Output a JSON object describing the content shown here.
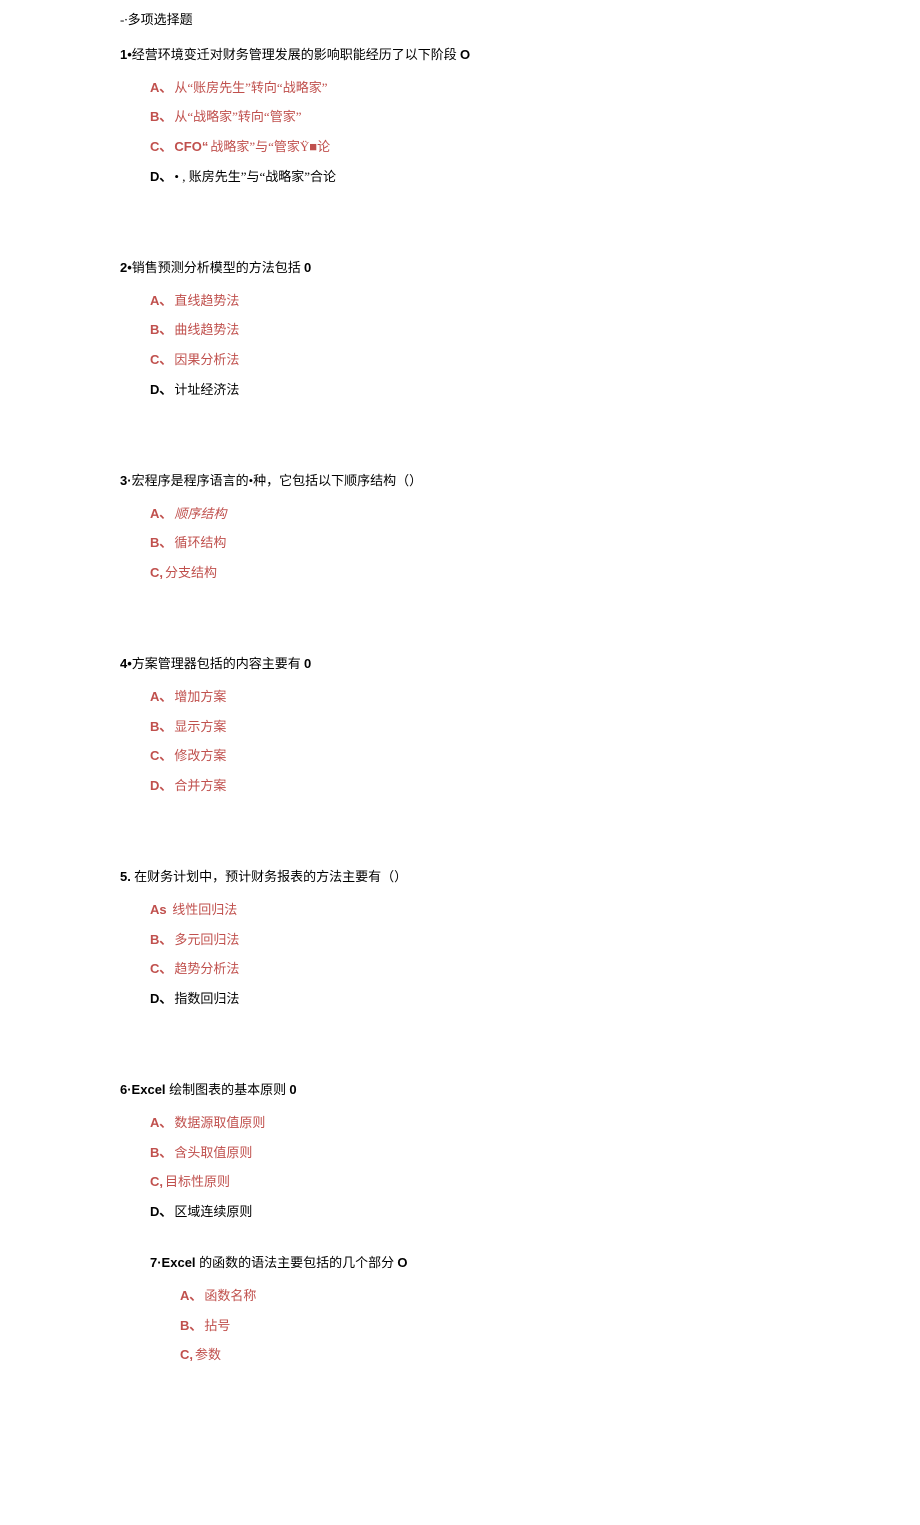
{
  "heading": "-∙多项选择题",
  "q1": {
    "stem_pre": "1•",
    "stem_txt": "经营环境变迁对财务管理发展的影响职能经历了以下阶段 ",
    "stem_suf": "O",
    "a_l": "A、",
    "a_t": "从“账房先生”转向“战略家”",
    "b_l": "B、",
    "b_t": "从“战略家”转向“管家”",
    "c_l": "C、",
    "c_rt": "CFO“",
    "c_t": "战略家”与“管家Ÿ■论",
    "d_l": "D、",
    "d_t": "• , 账房先生”与“战略家”合论"
  },
  "q2": {
    "stem_pre": "2•",
    "stem_txt": "销售预测分析模型的方法包括 ",
    "stem_suf": "0",
    "a_l": "A、",
    "a_t": "直线趋势法",
    "b_l": "B、",
    "b_t": "曲线趋势法",
    "c_l": "C、",
    "c_t": "因果分析法",
    "d_l": "D、",
    "d_t": "计址经济法"
  },
  "q3": {
    "stem_pre": "3·",
    "stem_txt": "宏程序是程序语言的•种，它包括以下顺序结构（）",
    "a_l": "A、",
    "a_t": "顺序结构",
    "b_l": "B、",
    "b_t": "循环结构",
    "c_l": "C,",
    "c_t": "分支结构"
  },
  "q4": {
    "stem_pre": "4•",
    "stem_txt": "方案管理器包括的内容主要有 ",
    "stem_suf": "0",
    "a_l": "A、",
    "a_t": "增加方案",
    "b_l": "B、",
    "b_t": "显示方案",
    "c_l": "C、",
    "c_t": "修改方案",
    "d_l": "D、",
    "d_t": "合并方案"
  },
  "q5": {
    "stem_pre": "5.",
    "stem_txt": " 在财务计划中，预计财务报表的方法主要有（）",
    "a_l": "As ",
    "a_t": "线性回归法",
    "b_l": "B、",
    "b_t": "多元回归法",
    "c_l": "C、",
    "c_t": "趋势分析法",
    "d_l": "D、",
    "d_t": "指数回归法"
  },
  "q6": {
    "stem_pre": "6·Excel ",
    "stem_txt": "绘制图表的基本原则 ",
    "stem_suf": "0",
    "a_l": "A、",
    "a_t": "数据源取值原则",
    "b_l": "B、",
    "b_t": "含头取值原则",
    "c_l": "C,",
    "c_t": "目标性原则",
    "d_l": "D、",
    "d_t": "区域连续原则"
  },
  "q7": {
    "stem_pre": "7·Excel ",
    "stem_txt": "的函数的语法主要包括的几个部分 ",
    "stem_suf": "O",
    "a_l": "A、",
    "a_t": "函数名称",
    "b_l": "B、",
    "b_t": "拈号",
    "c_l": "C,",
    "c_t": "参数"
  }
}
